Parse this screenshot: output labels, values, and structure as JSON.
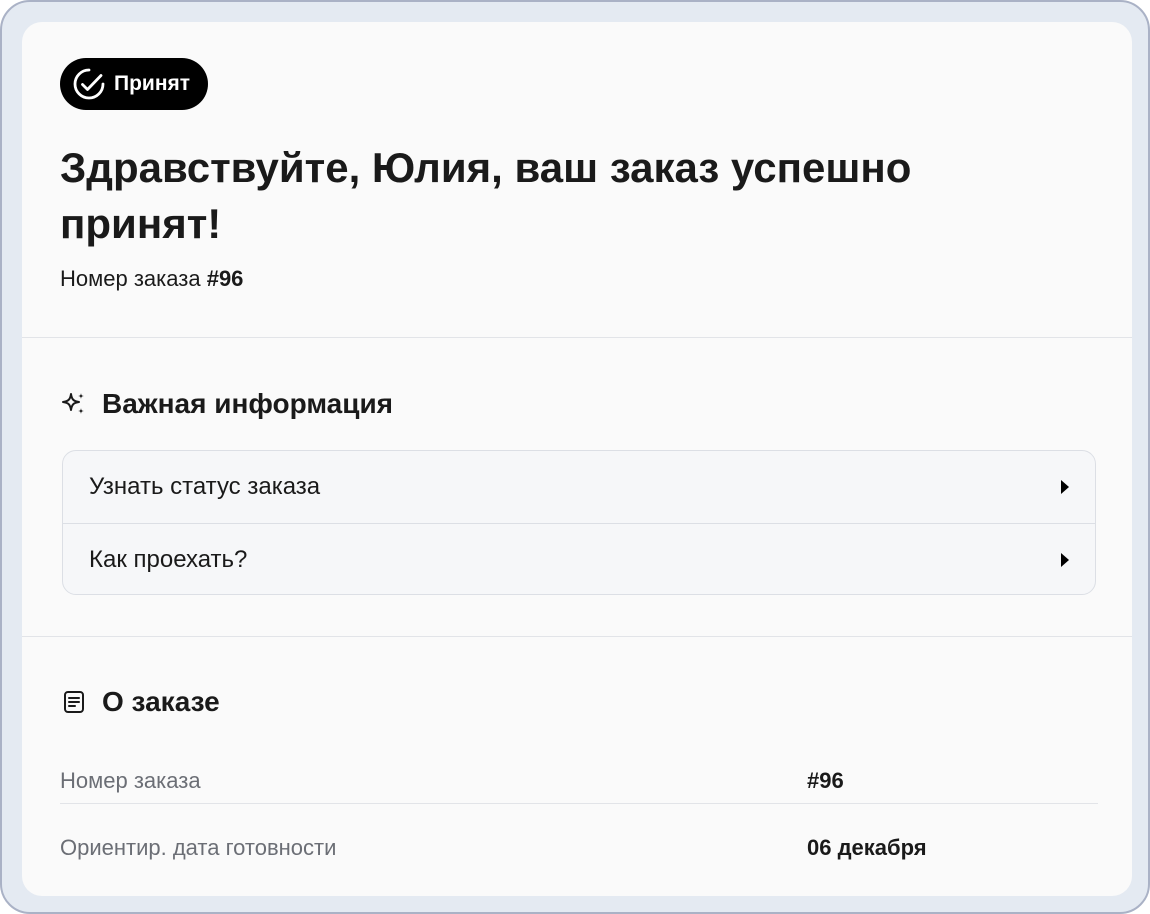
{
  "status_badge": {
    "label": "Принят",
    "icon": "check-circle-icon"
  },
  "heading": "Здравствуйте, Юлия, ваш заказ успешно принят!",
  "order_line": {
    "prefix": "Номер заказа",
    "number": "#96"
  },
  "important": {
    "title": "Важная информация",
    "icon": "sparkles-icon",
    "items": [
      {
        "label": "Узнать статус заказа"
      },
      {
        "label": "Как проехать?"
      }
    ]
  },
  "about": {
    "title": "О заказе",
    "icon": "document-icon",
    "rows": [
      {
        "label": "Номер заказа",
        "value": "#96"
      },
      {
        "label": "Ориентир. дата готовности",
        "value": "06 декабря"
      }
    ]
  }
}
